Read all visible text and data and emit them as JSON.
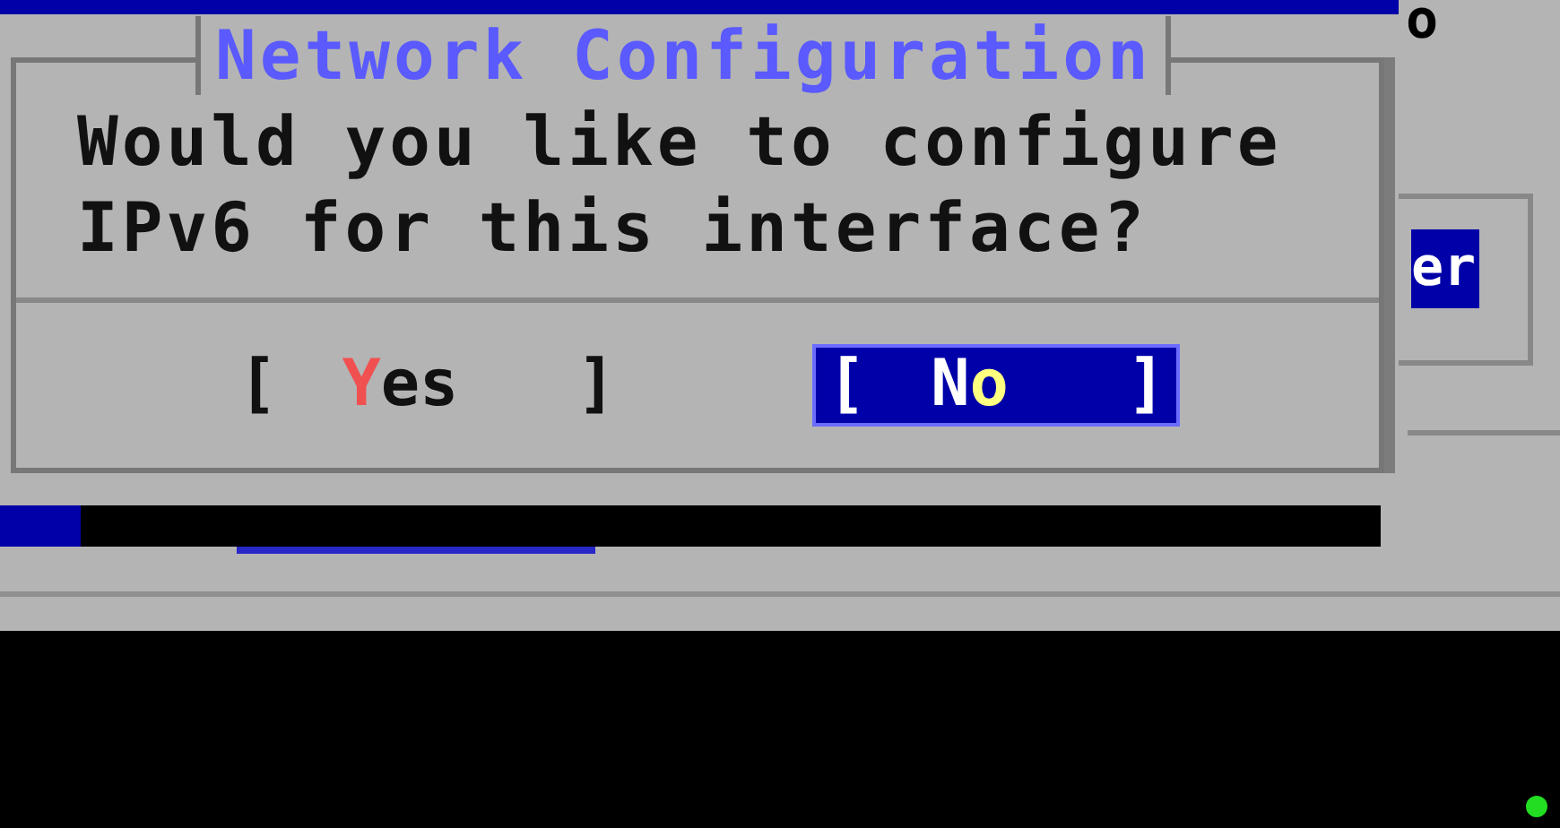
{
  "background_window": {
    "corner_text": "o",
    "button_text": "er"
  },
  "dialog": {
    "title": "Network Configuration",
    "message": [
      "Would you like to configure",
      "IPv6 for this interface?"
    ],
    "buttons": [
      {
        "left": "[",
        "hotkey": "Y",
        "rest": "es",
        "right": "]",
        "selected": false
      },
      {
        "left": "[",
        "hotkey": "N",
        "rest": "o",
        "right": "]",
        "selected": true
      }
    ]
  }
}
